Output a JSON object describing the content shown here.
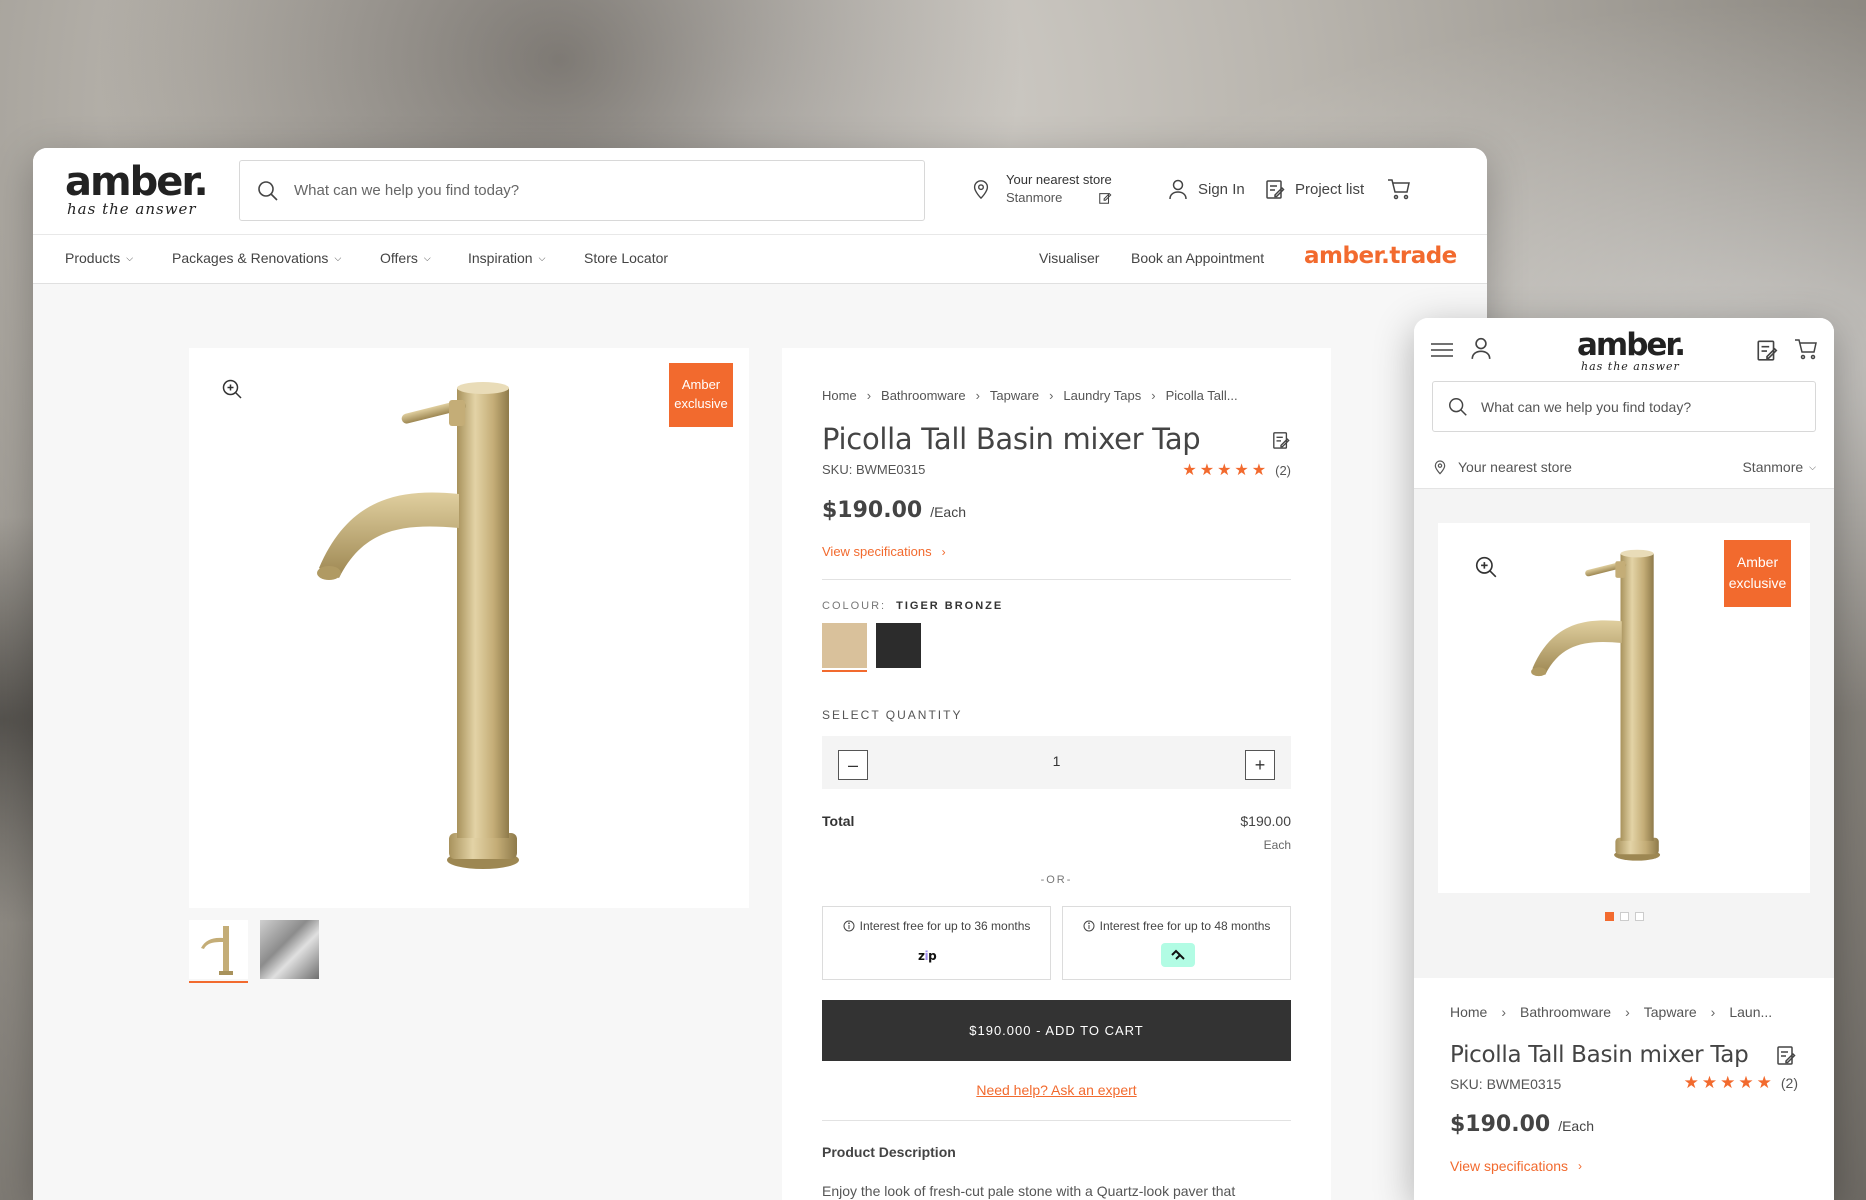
{
  "brand": {
    "logo_word": "amber.",
    "logo_tag": "has the answer",
    "trade_logo": "amber.trade",
    "accent_color": "#f26a2e"
  },
  "header": {
    "search_placeholder": "What can we help you find today?",
    "store_label": "Your nearest store",
    "store_name": "Stanmore",
    "sign_in": "Sign In",
    "project_list": "Project list"
  },
  "nav": {
    "items": [
      {
        "label": "Products"
      },
      {
        "label": "Packages & Renovations"
      },
      {
        "label": "Offers"
      },
      {
        "label": "Inspiration"
      },
      {
        "label": "Store Locator"
      }
    ],
    "right": [
      {
        "label": "Visualiser"
      },
      {
        "label": "Book an Appointment"
      }
    ]
  },
  "product": {
    "badge_line1": "Amber",
    "badge_line2": "exclusive",
    "breadcrumbs_desktop": [
      "Home",
      "Bathroomware",
      "Tapware",
      "Laundry Taps",
      "Picolla Tall..."
    ],
    "breadcrumbs_mobile": [
      "Home",
      "Bathroomware",
      "Tapware",
      "Laun..."
    ],
    "title": "Picolla Tall Basin mixer Tap",
    "sku": "SKU: BWME0315",
    "stars": "★★★★★",
    "rating_count": "(2)",
    "price": "$190.00",
    "price_unit": "/Each",
    "view_specs": "View specifications",
    "colour_label": "COLOUR:",
    "colour_value": "TIGER BRONZE",
    "swatches": [
      "#d9c19b",
      "#2c2c2c"
    ],
    "qty_label": "SELECT QUANTITY",
    "qty_value": "1",
    "total_label": "Total",
    "total_value": "$190.00",
    "total_each": "Each",
    "or_text": "-OR-",
    "pay1_text": "Interest free for up to 36 months",
    "pay1_logo": "zip",
    "pay2_text": "Interest free for up to 48 months",
    "add_to_cart": "$190.000 - ADD TO CART",
    "help_text": "Need help? Ask an expert",
    "desc_title": "Product Description",
    "desc_text": "Enjoy the look of fresh-cut pale stone with a Quartz-look paver that"
  },
  "mobile": {
    "search_placeholder": "What can we help you find today?",
    "store_label": "Your nearest store",
    "store_name": "Stanmore",
    "carousel_active": 1,
    "carousel_count": 3
  }
}
